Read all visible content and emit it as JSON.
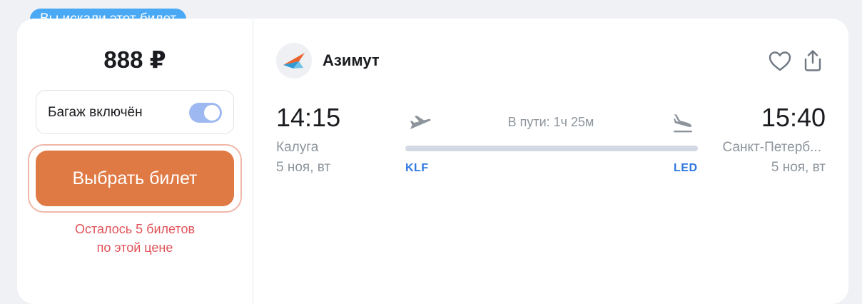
{
  "badge": "Вы искали этот билет",
  "price": "888 ₽",
  "baggage": {
    "label": "Багаж включён",
    "toggle_on": true
  },
  "select_button": "Выбрать билет",
  "remaining": {
    "line1": "Осталось 5 билетов",
    "line2": "по этой цене"
  },
  "airline": {
    "name": "Азимут",
    "logo_icon": "azimut-logo"
  },
  "icons": {
    "favorite": "heart-icon",
    "share": "share-icon",
    "takeoff": "plane-takeoff-icon",
    "landing": "plane-landing-icon"
  },
  "departure": {
    "time": "14:15",
    "city": "Калуга",
    "date": "5 ноя, вт",
    "code": "KLF"
  },
  "arrival": {
    "time": "15:40",
    "city": "Санкт-Петерб...",
    "date": "5 ноя, вт",
    "code": "LED"
  },
  "duration": "В пути: 1ч 25м",
  "colors": {
    "accent_button": "#e07a44",
    "badge": "#4aa9f5",
    "warning_text": "#e0545a",
    "iata_code": "#2f78e0"
  }
}
